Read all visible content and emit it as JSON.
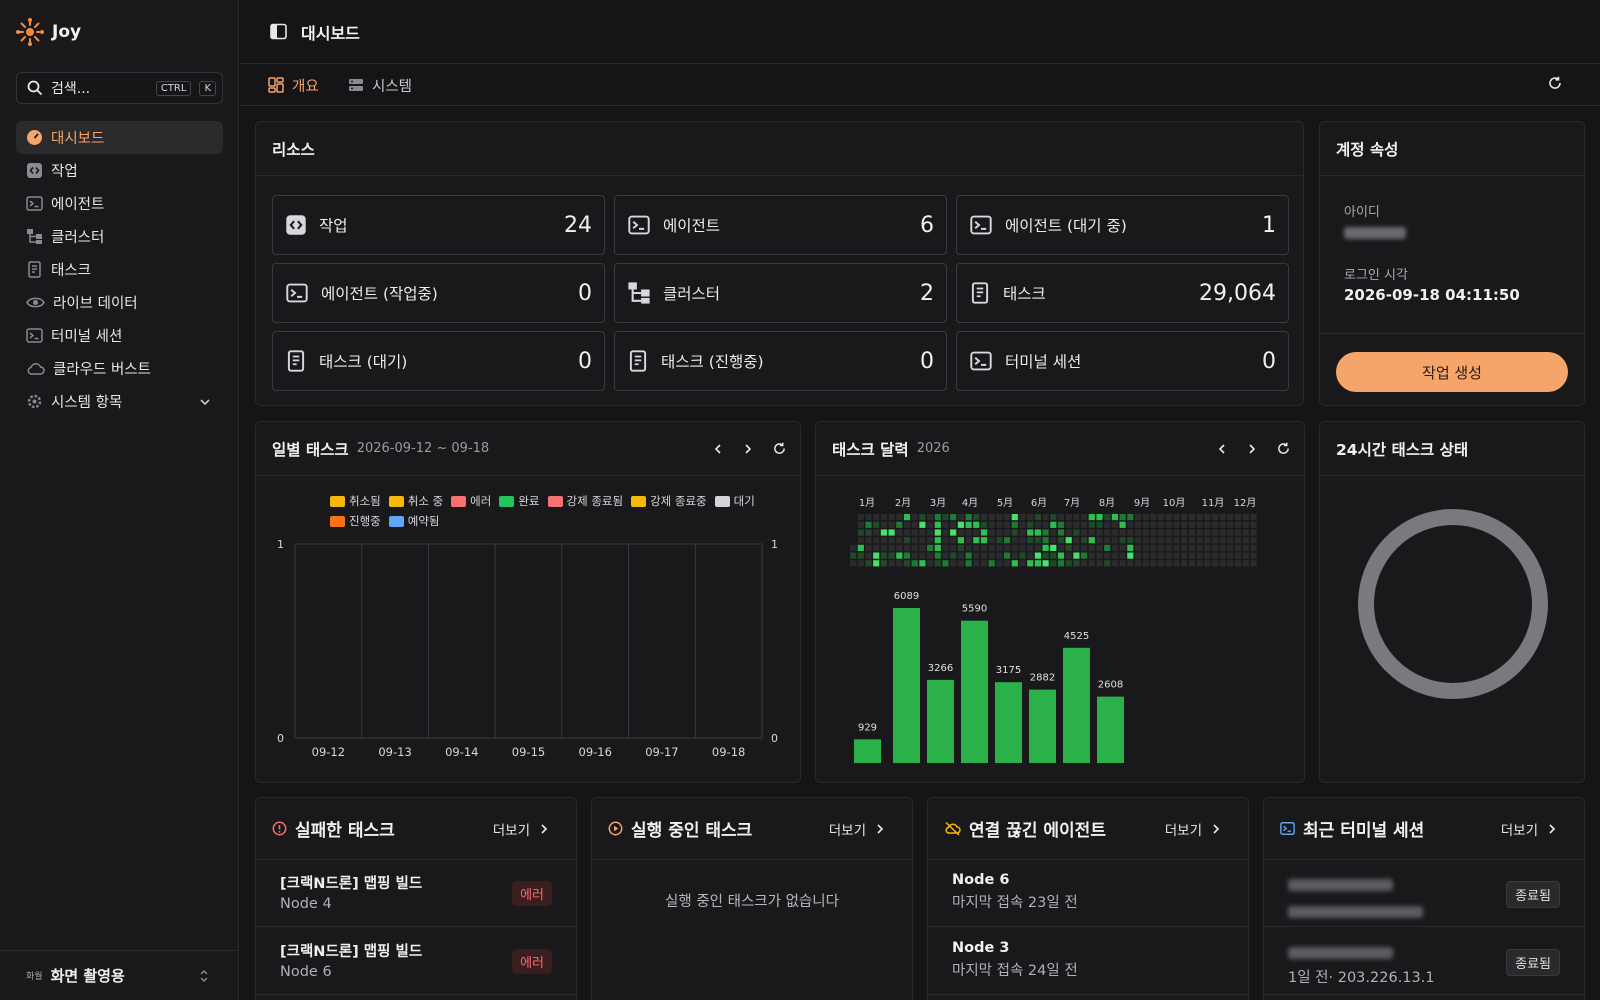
{
  "app": {
    "name": "Joy"
  },
  "search": {
    "placeholder": "검색...",
    "key1": "CTRL",
    "key2": "K"
  },
  "sidebar": {
    "items": [
      {
        "label": "대시보드",
        "icon": "dashboard-icon",
        "active": true
      },
      {
        "label": "작업",
        "icon": "code-icon"
      },
      {
        "label": "에이전트",
        "icon": "terminal-icon"
      },
      {
        "label": "클러스터",
        "icon": "cluster-icon"
      },
      {
        "label": "태스크",
        "icon": "task-icon"
      },
      {
        "label": "라이브 데이터",
        "icon": "eye-icon"
      },
      {
        "label": "터미널 세션",
        "icon": "terminal-icon"
      },
      {
        "label": "클라우드 버스트",
        "icon": "cloud-icon"
      },
      {
        "label": "시스템 항목",
        "icon": "gear-icon",
        "expandable": true
      }
    ],
    "footer": {
      "tag": "화월",
      "label": "화면 촬영용"
    }
  },
  "header": {
    "title": "대시보드"
  },
  "tabs": [
    {
      "label": "개요",
      "active": true
    },
    {
      "label": "시스템"
    }
  ],
  "resources": {
    "title": "리소스",
    "cards": [
      {
        "label": "작업",
        "value": "24",
        "icon": "code-icon"
      },
      {
        "label": "에이전트",
        "value": "6",
        "icon": "terminal-icon"
      },
      {
        "label": "에이전트 (대기 중)",
        "value": "1",
        "icon": "terminal-icon"
      },
      {
        "label": "에이전트 (작업중)",
        "value": "0",
        "icon": "terminal-icon"
      },
      {
        "label": "클러스터",
        "value": "2",
        "icon": "cluster-icon"
      },
      {
        "label": "태스크",
        "value": "29,064",
        "icon": "task-icon"
      },
      {
        "label": "태스크 (대기)",
        "value": "0",
        "icon": "task-icon"
      },
      {
        "label": "태스크 (진행중)",
        "value": "0",
        "icon": "task-icon"
      },
      {
        "label": "터미널 세션",
        "value": "0",
        "icon": "terminal-icon"
      }
    ]
  },
  "account": {
    "title": "계정 속성",
    "id_label": "아이디",
    "login_label": "로그인 시각",
    "login_value": "2026-09-18 04:11:50",
    "create_button": "작업 생성"
  },
  "daily": {
    "title": "일별 태스크",
    "range": "2026-09-12 ~ 09-18",
    "legend": [
      {
        "label": "취소됨",
        "color": "#f5b80b"
      },
      {
        "label": "취소 중",
        "color": "#f5b80b"
      },
      {
        "label": "에러",
        "color": "#f87171"
      },
      {
        "label": "완료",
        "color": "#22c55e"
      },
      {
        "label": "강제 종료됨",
        "color": "#f87171"
      },
      {
        "label": "강제 종료중",
        "color": "#f5b80b"
      },
      {
        "label": "대기",
        "color": "#d4d4d8"
      },
      {
        "label": "진행중",
        "color": "#f97316"
      },
      {
        "label": "예약됨",
        "color": "#60a5fa"
      }
    ],
    "chart_data": {
      "type": "bar",
      "categories": [
        "09-12",
        "09-13",
        "09-14",
        "09-15",
        "09-16",
        "09-17",
        "09-18"
      ],
      "values": [
        0,
        0,
        0,
        0,
        0,
        0,
        0
      ],
      "ylim": [
        0,
        1
      ],
      "ytick_labels": [
        "0",
        "1"
      ],
      "title": "",
      "xlabel": "",
      "ylabel": ""
    }
  },
  "calendar": {
    "title": "태스크 달력",
    "year": "2026",
    "months": [
      "1月",
      "2月",
      "3月",
      "4月",
      "5月",
      "6月",
      "7月",
      "8月",
      "9月",
      "10月",
      "11月",
      "12月"
    ],
    "chart_data": {
      "type": "bar",
      "categories": [
        "1月",
        "2月",
        "3月",
        "4月",
        "5月",
        "6月",
        "7月",
        "8月"
      ],
      "values": [
        929,
        6089,
        3266,
        5590,
        3175,
        2882,
        4525,
        2608
      ],
      "title": "",
      "xlabel": "",
      "ylabel": ""
    }
  },
  "status24": {
    "title": "24시간 태스크 상태"
  },
  "failed": {
    "title": "실패한 태스크",
    "more": "더보기",
    "items": [
      {
        "title": "[크랙N드론] 맵핑 빌드",
        "sub": "Node 4",
        "badge": "에러"
      },
      {
        "title": "[크랙N드론] 맵핑 빌드",
        "sub": "Node 6",
        "badge": "에러"
      }
    ]
  },
  "running": {
    "title": "실행 중인 태스크",
    "more": "더보기",
    "empty": "실행 중인 태스크가 없습니다"
  },
  "disconnected": {
    "title": "연결 끊긴 에이전트",
    "more": "더보기",
    "items": [
      {
        "title": "Node 6",
        "sub": "마지막 접속 23일 전"
      },
      {
        "title": "Node 3",
        "sub": "마지막 접속 24일 전"
      }
    ]
  },
  "terminals": {
    "title": "최근 터미널 세션",
    "more": "더보기",
    "items": [
      {
        "sub": "",
        "badge": "종료됨"
      },
      {
        "sub": "1일 전· 203.226.13.1",
        "badge": "종료됨"
      }
    ]
  },
  "colors": {
    "accent": "#f5a46a",
    "green": "#22c55e",
    "error": "#ff6b6b",
    "bg": "#151517",
    "panel": "#19191b"
  }
}
